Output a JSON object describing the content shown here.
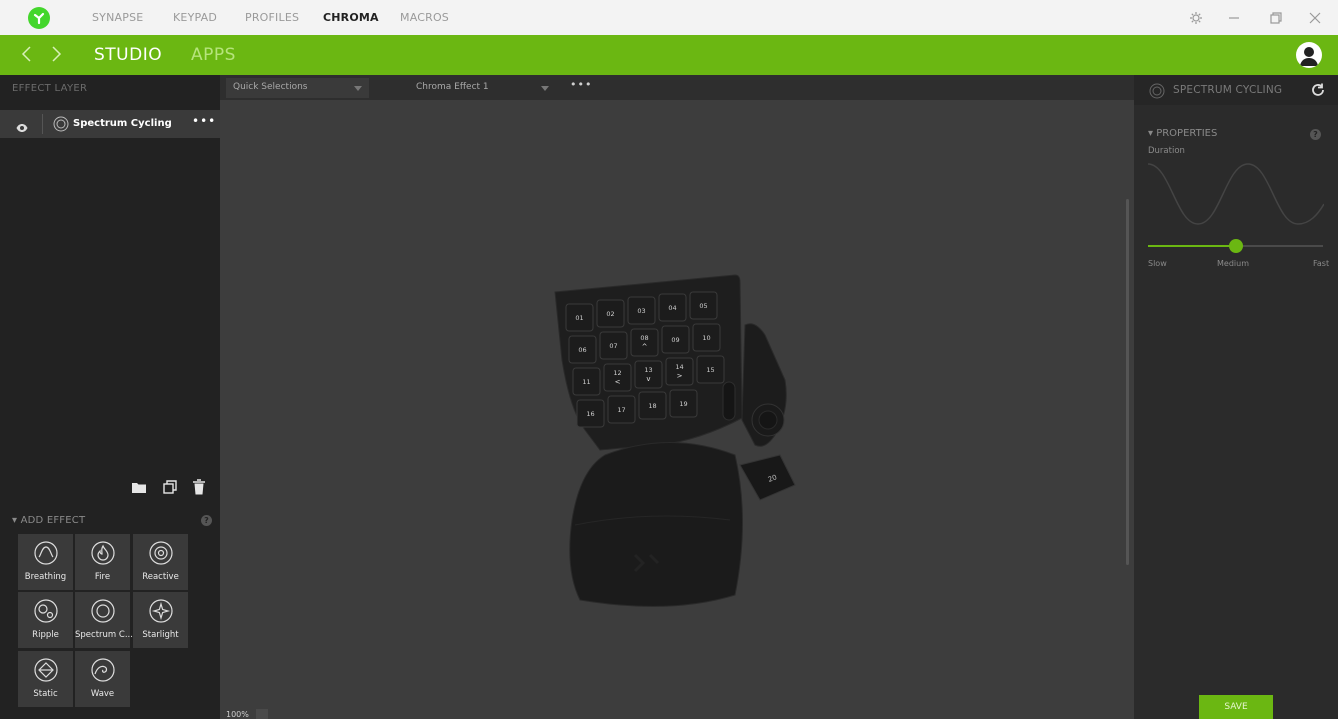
{
  "titlebar": {
    "tabs": [
      {
        "label": "SYNAPSE",
        "active": false
      },
      {
        "label": "KEYPAD",
        "active": false
      },
      {
        "label": "PROFILES",
        "active": false
      },
      {
        "label": "CHROMA",
        "active": true
      },
      {
        "label": "MACROS",
        "active": false
      }
    ],
    "window_icons": [
      "settings-icon",
      "minimize-icon",
      "restore-icon",
      "close-icon"
    ]
  },
  "navbar": {
    "tabs": [
      {
        "label": "STUDIO",
        "active": true
      },
      {
        "label": "APPS",
        "active": false
      }
    ],
    "accent_color": "#6bb712"
  },
  "left_panel": {
    "header": "EFFECT LAYER",
    "layers": [
      {
        "name": "Spectrum Cycling",
        "visible": true,
        "more": "•••"
      }
    ],
    "tool_icons": [
      "folder-icon",
      "duplicate-icon",
      "trash-icon"
    ],
    "add_effect": {
      "header": "ADD EFFECT",
      "help": "?",
      "effects": [
        {
          "label": "Breathing",
          "icon": "breathing-icon"
        },
        {
          "label": "Fire",
          "icon": "fire-icon"
        },
        {
          "label": "Reactive",
          "icon": "reactive-icon"
        },
        {
          "label": "Ripple",
          "icon": "ripple-icon"
        },
        {
          "label": "Spectrum C...",
          "icon": "spectrum-cycling-icon"
        },
        {
          "label": "Starlight",
          "icon": "starlight-icon"
        },
        {
          "label": "Static",
          "icon": "static-icon"
        },
        {
          "label": "Wave",
          "icon": "wave-icon"
        }
      ]
    }
  },
  "center": {
    "quick_selections": "Quick Selections",
    "effect_select": "Chroma Effect 1",
    "more": "•••",
    "zoom": "100%",
    "device_keys": [
      {
        "label": "01"
      },
      {
        "label": "02"
      },
      {
        "label": "03"
      },
      {
        "label": "04"
      },
      {
        "label": "05"
      },
      {
        "label": "06"
      },
      {
        "label": "07"
      },
      {
        "label": "08",
        "glyph": "^"
      },
      {
        "label": "09"
      },
      {
        "label": "10"
      },
      {
        "label": "11"
      },
      {
        "label": "12",
        "glyph": "<"
      },
      {
        "label": "13",
        "glyph": "v"
      },
      {
        "label": "14",
        "glyph": ">"
      },
      {
        "label": "15"
      },
      {
        "label": "16"
      },
      {
        "label": "17"
      },
      {
        "label": "18"
      },
      {
        "label": "19"
      },
      {
        "label": "20"
      }
    ]
  },
  "right_panel": {
    "effect_title": "SPECTRUM CYCLING",
    "properties_header": "PROPERTIES",
    "help": "?",
    "duration_label": "Duration",
    "slider": {
      "min_label": "Slow",
      "mid_label": "Medium",
      "max_label": "Fast",
      "value": 0.5
    },
    "save_label": "SAVE"
  }
}
